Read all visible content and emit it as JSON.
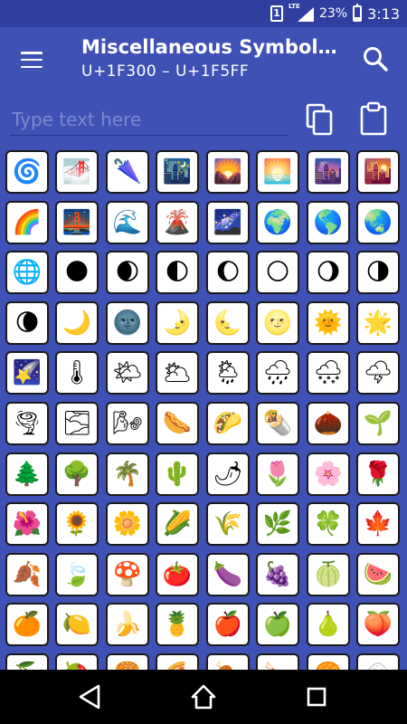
{
  "status_bar": {
    "sim_slot": "1",
    "network": "LTE",
    "battery": "23%",
    "battery_level": 0.23,
    "time": "3:13"
  },
  "app_bar": {
    "title": "Miscellaneous Symbol…",
    "subtitle": "U+1F300 – U+1F5FF",
    "menu_icon": "hamburger-menu-icon",
    "search_icon": "search-icon"
  },
  "text_row": {
    "placeholder": "Type text here",
    "value": "",
    "copy_icon": "copy-icon",
    "paste_icon": "clipboard-icon"
  },
  "symbols": [
    [
      "🌀",
      "🌁",
      "🌂",
      "🌃",
      "🌄",
      "🌅",
      "🌆",
      "🌇"
    ],
    [
      "🌈",
      "🌉",
      "🌊",
      "🌋",
      "🌌",
      "🌍",
      "🌎",
      "🌏"
    ],
    [
      "🌐",
      "🌑",
      "🌒",
      "🌓",
      "🌔",
      "🌕",
      "🌖",
      "🌗"
    ],
    [
      "🌘",
      "🌙",
      "🌚",
      "🌛",
      "🌜",
      "🌝",
      "🌞",
      "🌟"
    ],
    [
      "🌠",
      "🌡",
      "🌤",
      "🌥",
      "🌦",
      "🌧",
      "🌨",
      "🌩"
    ],
    [
      "🌪",
      "🌫",
      "🌬",
      "🌭",
      "🌮",
      "🌯",
      "🌰",
      "🌱"
    ],
    [
      "🌲",
      "🌳",
      "🌴",
      "🌵",
      "🌶",
      "🌷",
      "🌸",
      "🌹"
    ],
    [
      "🌺",
      "🌻",
      "🌼",
      "🌽",
      "🌾",
      "🌿",
      "🍀",
      "🍁"
    ],
    [
      "🍂",
      "🍃",
      "🍄",
      "🍅",
      "🍆",
      "🍇",
      "🍈",
      "🍉"
    ],
    [
      "🍊",
      "🍋",
      "🍌",
      "🍍",
      "🍎",
      "🍏",
      "🍐",
      "🍑"
    ],
    [
      "🍒",
      "🍓",
      "🍔",
      "🍕",
      "🍖",
      "🍗",
      "🍘",
      "🍙"
    ]
  ],
  "nav_bar": {
    "back_icon": "back-icon",
    "home_icon": "home-icon",
    "recents_icon": "recents-icon"
  }
}
